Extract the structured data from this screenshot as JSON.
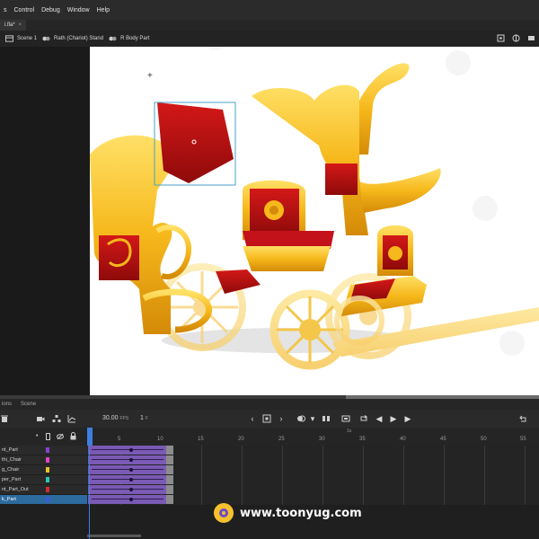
{
  "menubar": {
    "items": [
      "s",
      "Control",
      "Debug",
      "Window",
      "Help"
    ]
  },
  "document": {
    "tab_label": "i.fla*",
    "close_icon": "×"
  },
  "breadcrumb": {
    "scene": "Scene 1",
    "symbol1": "Rath (Chariot) Stand",
    "symbol2": "R Body Part"
  },
  "timeline": {
    "tabs": [
      "ions",
      "Scene"
    ],
    "fps": "30.00",
    "fps_unit": "FPS",
    "current_frame": "1",
    "current_frame_unit": "F",
    "seconds_marker": "1s",
    "ruler_labels": [
      "1",
      "5",
      "10",
      "15",
      "20",
      "25",
      "30",
      "35",
      "40",
      "45",
      "50",
      "55"
    ],
    "layers": [
      {
        "name": "nt_Part",
        "color": "#8b3fd0",
        "selected": false
      },
      {
        "name": "thi_Chair",
        "color": "#e043c8",
        "selected": false
      },
      {
        "name": "g_Chair",
        "color": "#e6c22a",
        "selected": false
      },
      {
        "name": "per_Part",
        "color": "#2fc4b9",
        "selected": false
      },
      {
        "name": "nt_Part_Out",
        "color": "#cf2d2d",
        "selected": false
      },
      {
        "name": "k_Part",
        "color": "#3a5bdc",
        "selected": true
      }
    ]
  },
  "watermark": {
    "url": "www.toonyug.com"
  }
}
